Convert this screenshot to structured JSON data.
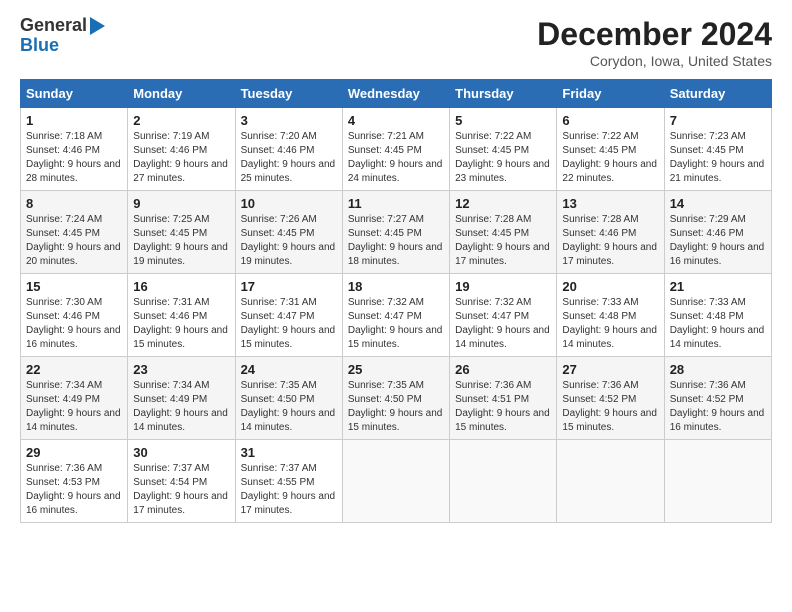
{
  "header": {
    "logo_line1": "General",
    "logo_line2": "Blue",
    "month_title": "December 2024",
    "location": "Corydon, Iowa, United States"
  },
  "days_of_week": [
    "Sunday",
    "Monday",
    "Tuesday",
    "Wednesday",
    "Thursday",
    "Friday",
    "Saturday"
  ],
  "weeks": [
    [
      {
        "num": "1",
        "sunrise": "7:18 AM",
        "sunset": "4:46 PM",
        "daylight": "9 hours and 28 minutes."
      },
      {
        "num": "2",
        "sunrise": "7:19 AM",
        "sunset": "4:46 PM",
        "daylight": "9 hours and 27 minutes."
      },
      {
        "num": "3",
        "sunrise": "7:20 AM",
        "sunset": "4:46 PM",
        "daylight": "9 hours and 25 minutes."
      },
      {
        "num": "4",
        "sunrise": "7:21 AM",
        "sunset": "4:45 PM",
        "daylight": "9 hours and 24 minutes."
      },
      {
        "num": "5",
        "sunrise": "7:22 AM",
        "sunset": "4:45 PM",
        "daylight": "9 hours and 23 minutes."
      },
      {
        "num": "6",
        "sunrise": "7:22 AM",
        "sunset": "4:45 PM",
        "daylight": "9 hours and 22 minutes."
      },
      {
        "num": "7",
        "sunrise": "7:23 AM",
        "sunset": "4:45 PM",
        "daylight": "9 hours and 21 minutes."
      }
    ],
    [
      {
        "num": "8",
        "sunrise": "7:24 AM",
        "sunset": "4:45 PM",
        "daylight": "9 hours and 20 minutes."
      },
      {
        "num": "9",
        "sunrise": "7:25 AM",
        "sunset": "4:45 PM",
        "daylight": "9 hours and 19 minutes."
      },
      {
        "num": "10",
        "sunrise": "7:26 AM",
        "sunset": "4:45 PM",
        "daylight": "9 hours and 19 minutes."
      },
      {
        "num": "11",
        "sunrise": "7:27 AM",
        "sunset": "4:45 PM",
        "daylight": "9 hours and 18 minutes."
      },
      {
        "num": "12",
        "sunrise": "7:28 AM",
        "sunset": "4:45 PM",
        "daylight": "9 hours and 17 minutes."
      },
      {
        "num": "13",
        "sunrise": "7:28 AM",
        "sunset": "4:46 PM",
        "daylight": "9 hours and 17 minutes."
      },
      {
        "num": "14",
        "sunrise": "7:29 AM",
        "sunset": "4:46 PM",
        "daylight": "9 hours and 16 minutes."
      }
    ],
    [
      {
        "num": "15",
        "sunrise": "7:30 AM",
        "sunset": "4:46 PM",
        "daylight": "9 hours and 16 minutes."
      },
      {
        "num": "16",
        "sunrise": "7:31 AM",
        "sunset": "4:46 PM",
        "daylight": "9 hours and 15 minutes."
      },
      {
        "num": "17",
        "sunrise": "7:31 AM",
        "sunset": "4:47 PM",
        "daylight": "9 hours and 15 minutes."
      },
      {
        "num": "18",
        "sunrise": "7:32 AM",
        "sunset": "4:47 PM",
        "daylight": "9 hours and 15 minutes."
      },
      {
        "num": "19",
        "sunrise": "7:32 AM",
        "sunset": "4:47 PM",
        "daylight": "9 hours and 14 minutes."
      },
      {
        "num": "20",
        "sunrise": "7:33 AM",
        "sunset": "4:48 PM",
        "daylight": "9 hours and 14 minutes."
      },
      {
        "num": "21",
        "sunrise": "7:33 AM",
        "sunset": "4:48 PM",
        "daylight": "9 hours and 14 minutes."
      }
    ],
    [
      {
        "num": "22",
        "sunrise": "7:34 AM",
        "sunset": "4:49 PM",
        "daylight": "9 hours and 14 minutes."
      },
      {
        "num": "23",
        "sunrise": "7:34 AM",
        "sunset": "4:49 PM",
        "daylight": "9 hours and 14 minutes."
      },
      {
        "num": "24",
        "sunrise": "7:35 AM",
        "sunset": "4:50 PM",
        "daylight": "9 hours and 14 minutes."
      },
      {
        "num": "25",
        "sunrise": "7:35 AM",
        "sunset": "4:50 PM",
        "daylight": "9 hours and 15 minutes."
      },
      {
        "num": "26",
        "sunrise": "7:36 AM",
        "sunset": "4:51 PM",
        "daylight": "9 hours and 15 minutes."
      },
      {
        "num": "27",
        "sunrise": "7:36 AM",
        "sunset": "4:52 PM",
        "daylight": "9 hours and 15 minutes."
      },
      {
        "num": "28",
        "sunrise": "7:36 AM",
        "sunset": "4:52 PM",
        "daylight": "9 hours and 16 minutes."
      }
    ],
    [
      {
        "num": "29",
        "sunrise": "7:36 AM",
        "sunset": "4:53 PM",
        "daylight": "9 hours and 16 minutes."
      },
      {
        "num": "30",
        "sunrise": "7:37 AM",
        "sunset": "4:54 PM",
        "daylight": "9 hours and 17 minutes."
      },
      {
        "num": "31",
        "sunrise": "7:37 AM",
        "sunset": "4:55 PM",
        "daylight": "9 hours and 17 minutes."
      },
      null,
      null,
      null,
      null
    ]
  ]
}
